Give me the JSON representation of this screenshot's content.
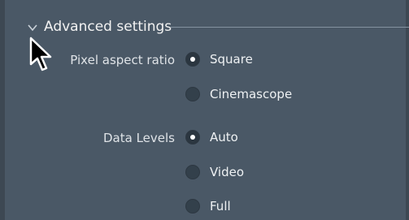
{
  "advanced": {
    "title": "Advanced settings",
    "expanded": true
  },
  "pixel_aspect_ratio": {
    "label": "Pixel aspect ratio",
    "options": [
      "Square",
      "Cinemascope"
    ],
    "selected": "Square"
  },
  "data_levels": {
    "label": "Data Levels",
    "options": [
      "Auto",
      "Video",
      "Full"
    ],
    "selected": "Auto"
  },
  "icons": {
    "chevron": "chevron-down-icon",
    "cursor": "mouse-pointer-icon"
  },
  "colors": {
    "panel_bg": "#4a5866",
    "radio_fill": "#33404b",
    "radio_dot": "#ffffff",
    "text": "#eef1f3"
  }
}
